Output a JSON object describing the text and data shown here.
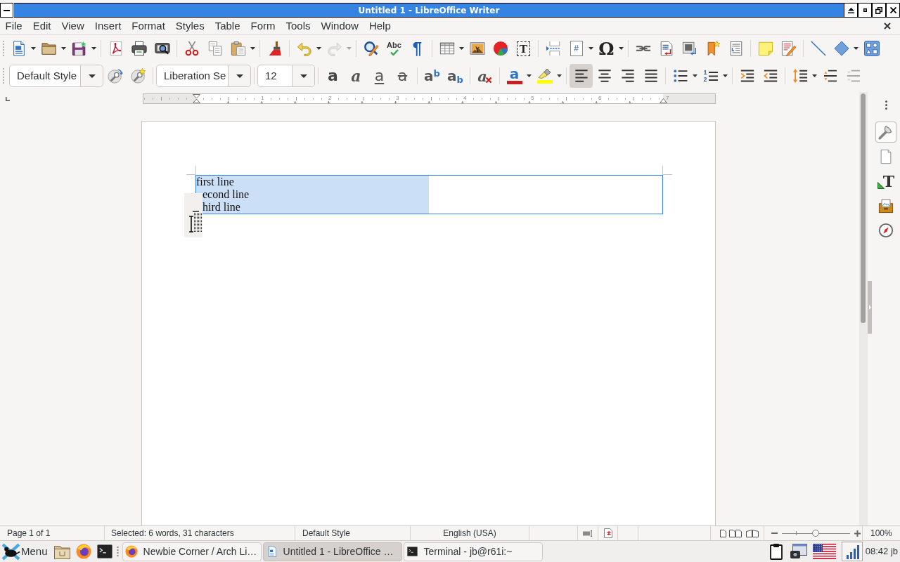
{
  "window": {
    "title": "Untitled 1 - LibreOffice Writer"
  },
  "menu_bar": [
    "File",
    "Edit",
    "View",
    "Insert",
    "Format",
    "Styles",
    "Table",
    "Form",
    "Tools",
    "Window",
    "Help"
  ],
  "standard_toolbar": [
    [
      {
        "kind": "new",
        "dropdown": true,
        "disabled": false
      },
      {
        "kind": "open",
        "dropdown": true,
        "disabled": false
      },
      {
        "kind": "save",
        "dropdown": true,
        "disabled": false
      }
    ],
    [
      {
        "kind": "pdf",
        "dropdown": false,
        "disabled": false
      },
      {
        "kind": "print",
        "dropdown": false,
        "disabled": false
      },
      {
        "kind": "preview",
        "dropdown": false,
        "disabled": false
      }
    ],
    [
      {
        "kind": "cut",
        "dropdown": false,
        "disabled": false
      },
      {
        "kind": "copy",
        "dropdown": false,
        "disabled": false
      },
      {
        "kind": "paste",
        "dropdown": true,
        "disabled": false
      }
    ],
    [
      {
        "kind": "clone",
        "dropdown": false,
        "disabled": false
      }
    ],
    [
      {
        "kind": "undo",
        "dropdown": true,
        "disabled": false
      },
      {
        "kind": "redo",
        "dropdown": true,
        "disabled": true
      }
    ],
    [
      {
        "kind": "find",
        "dropdown": false,
        "disabled": false
      },
      {
        "kind": "spelling",
        "glyph": "Abc",
        "dropdown": false,
        "disabled": false
      },
      {
        "kind": "marks",
        "glyph": "¶",
        "dropdown": false,
        "disabled": false
      }
    ],
    [
      {
        "kind": "table",
        "dropdown": true,
        "disabled": false
      },
      {
        "kind": "image",
        "dropdown": false,
        "disabled": false
      },
      {
        "kind": "chart",
        "dropdown": false,
        "disabled": false
      },
      {
        "kind": "textbox",
        "glyph": "T",
        "dropdown": false,
        "disabled": false
      }
    ],
    [
      {
        "kind": "pagebreak",
        "dropdown": false,
        "disabled": false
      },
      {
        "kind": "field",
        "glyph": "#",
        "dropdown": true,
        "disabled": false
      },
      {
        "kind": "symbol",
        "glyph": "Ω",
        "dropdown": true,
        "disabled": false
      }
    ],
    [
      {
        "kind": "hyperlink",
        "dropdown": false,
        "disabled": false
      },
      {
        "kind": "footnote",
        "dropdown": false,
        "disabled": false
      },
      {
        "kind": "endnote",
        "dropdown": false,
        "disabled": false
      },
      {
        "kind": "bookmark",
        "dropdown": false,
        "disabled": false
      },
      {
        "kind": "crossref",
        "dropdown": false,
        "disabled": false
      }
    ],
    [
      {
        "kind": "comment",
        "dropdown": false,
        "disabled": false
      },
      {
        "kind": "track",
        "dropdown": false,
        "disabled": false
      }
    ],
    [
      {
        "kind": "line",
        "dropdown": false,
        "disabled": false
      },
      {
        "kind": "shape",
        "dropdown": true,
        "disabled": false
      },
      {
        "kind": "draw",
        "dropdown": false,
        "disabled": false
      }
    ]
  ],
  "formatting_toolbar": [
    [
      {
        "kind": "stylebox",
        "value": "Default Style"
      },
      {
        "kind": "updatestyle",
        "dropdown": false,
        "disabled": false
      },
      {
        "kind": "newstyle",
        "dropdown": false,
        "disabled": false
      }
    ],
    [
      {
        "kind": "fontbox",
        "value": "Liberation Se"
      }
    ],
    [
      {
        "kind": "sizebox",
        "value": "12"
      }
    ],
    [
      {
        "kind": "bold",
        "glyph": "a",
        "selected": false,
        "dropdown": false,
        "disabled": false
      },
      {
        "kind": "italic",
        "glyph": "a",
        "selected": false,
        "dropdown": false,
        "disabled": false
      },
      {
        "kind": "underline",
        "glyph": "a",
        "selected": false,
        "dropdown": false,
        "disabled": false
      },
      {
        "kind": "strike",
        "glyph": "a",
        "selected": false,
        "dropdown": false,
        "disabled": false
      }
    ],
    [
      {
        "kind": "superscript",
        "glyph": "a$^{b}$",
        "selected": false,
        "dropdown": false,
        "disabled": false
      },
      {
        "kind": "subscript",
        "glyph": "a$_{b}$",
        "selected": false,
        "dropdown": false,
        "disabled": false
      }
    ],
    [
      {
        "kind": "clear",
        "glyph": "a",
        "dropdown": false,
        "disabled": false
      }
    ],
    [
      {
        "kind": "fontcolor",
        "glyph": "a",
        "color": "#c9211e",
        "dropdown": true,
        "disabled": false
      },
      {
        "kind": "highlight",
        "color": "#ffff00",
        "dropdown": true,
        "disabled": false
      }
    ],
    [
      {
        "kind": "alignleft",
        "selected": true,
        "dropdown": false,
        "disabled": false
      },
      {
        "kind": "aligncenter",
        "selected": false,
        "dropdown": false,
        "disabled": false
      },
      {
        "kind": "alignright",
        "selected": false,
        "dropdown": false,
        "disabled": false
      },
      {
        "kind": "justify",
        "selected": false,
        "dropdown": false,
        "disabled": false
      }
    ],
    [
      {
        "kind": "bullets",
        "dropdown": true,
        "disabled": false
      },
      {
        "kind": "numbering",
        "glyph": "12",
        "dropdown": true,
        "disabled": false
      }
    ],
    [
      {
        "kind": "indent",
        "dropdown": false,
        "disabled": false
      },
      {
        "kind": "outdent",
        "dropdown": false,
        "disabled": false
      }
    ],
    [
      {
        "kind": "linespacing",
        "dropdown": true,
        "disabled": false
      },
      {
        "kind": "spaceup",
        "dropdown": false,
        "disabled": false
      },
      {
        "kind": "spacedown",
        "dropdown": false,
        "disabled": true
      }
    ]
  ],
  "ruler": {
    "numbers": [
      "1",
      "2",
      "3",
      "4",
      "5",
      "6",
      "7"
    ]
  },
  "document": {
    "lines": [
      {
        "text": "first line",
        "selected": true
      },
      {
        "text": "econd line",
        "selected": true
      },
      {
        "text": "hird line",
        "selected": true
      }
    ]
  },
  "sidebar": [
    {
      "kind": "properties",
      "selected": true
    },
    {
      "kind": "page",
      "selected": false
    },
    {
      "kind": "styles",
      "glyph": "T",
      "selected": false
    },
    {
      "kind": "gallery",
      "selected": false
    },
    {
      "kind": "navigator",
      "selected": false
    }
  ],
  "status_bar": {
    "page": "Page 1 of 1",
    "selection": "Selected: 6 words, 31 characters",
    "page_style": "Default Style",
    "language": "English (USA)",
    "zoom": {
      "level": 0.49,
      "reading": "100%"
    }
  },
  "taskbar": {
    "menu_label": "Menu",
    "launchers": [
      {
        "kind": "files"
      },
      {
        "kind": "browser"
      },
      {
        "kind": "terminal"
      }
    ],
    "tasks": [
      {
        "kind": "browser",
        "label": "Newbie Corner / Arch Li…",
        "selected": false
      },
      {
        "kind": "writer",
        "label": "Untitled 1 - LibreOffice …",
        "selected": true
      },
      {
        "kind": "terminal",
        "label": "Terminal - jb@r61i:~",
        "selected": false
      }
    ],
    "tray": [
      {
        "kind": "clipboard"
      },
      {
        "kind": "screenshot"
      },
      {
        "kind": "keyboard"
      },
      {
        "kind": "network"
      }
    ],
    "clock": "08:42 jb"
  }
}
